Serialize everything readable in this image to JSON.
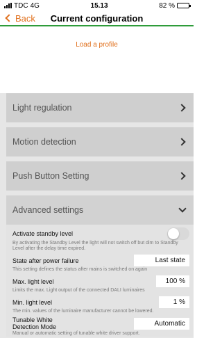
{
  "status_bar": {
    "carrier": "TDC",
    "network": "4G",
    "time": "15.13",
    "battery": "82 %",
    "battery_level": 0.82
  },
  "nav": {
    "back_label": "Back",
    "title": "Current configuration"
  },
  "load_profile_label": "Load a profile",
  "sections": [
    {
      "label": "Light regulation"
    },
    {
      "label": "Motion detection"
    },
    {
      "label": "Push Button Setting"
    },
    {
      "label": "Advanced settings"
    }
  ],
  "advanced": {
    "standby": {
      "label": "Activate standby level",
      "enabled": false,
      "desc": "By activating the Standby Level the light will not switch off but  dim to Standby Level after the delay time expired."
    },
    "power_failure": {
      "label": "State after power failure",
      "value": "Last state",
      "desc": "This setting defines the status after mains is switched on again"
    },
    "max_light": {
      "label": "Max. light level",
      "value": "100 %",
      "desc": "Limits the max. Light output of the connected DALI luminaires"
    },
    "min_light": {
      "label": "Min. light level",
      "value": "1 %",
      "desc": "The min. values of the luminaire manufacturer cannot be lowered."
    },
    "tunable_white": {
      "label_line1": "Tunable White",
      "label_line2": "Detection Mode",
      "value": "Automatic",
      "desc": "Manual or automatic setting of tunable white driver support."
    }
  },
  "colors": {
    "accent": "#e0701d",
    "divider": "#2e9c3a",
    "section_bg": "#cfcfcf",
    "panel_bg": "#e3e3e3"
  }
}
